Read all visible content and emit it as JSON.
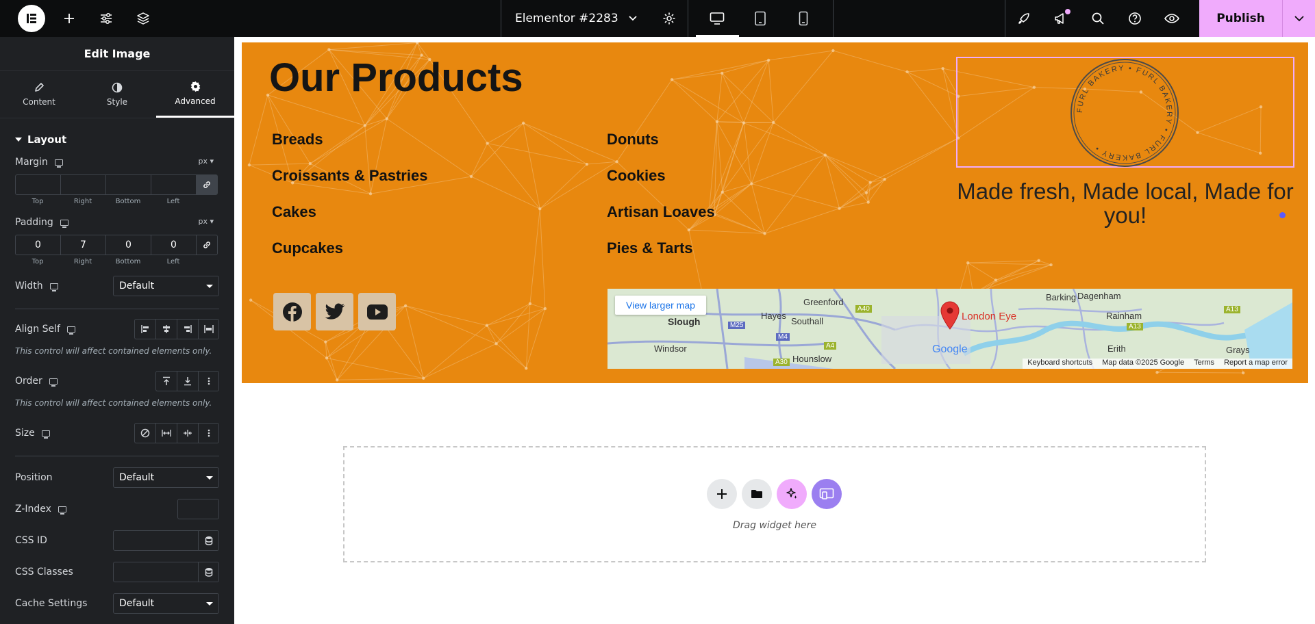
{
  "topbar": {
    "doc_title": "Elementor #2283",
    "publish_label": "Publish"
  },
  "panel": {
    "title": "Edit Image",
    "tabs": [
      {
        "label": "Content",
        "icon": "pencil-icon"
      },
      {
        "label": "Style",
        "icon": "half-circle-icon"
      },
      {
        "label": "Advanced",
        "icon": "gear-icon",
        "active": true
      }
    ],
    "section": "Layout",
    "margin": {
      "label": "Margin",
      "unit": "px",
      "top": "",
      "right": "",
      "bottom": "",
      "left": ""
    },
    "padding": {
      "label": "Padding",
      "unit": "px",
      "top": "0",
      "right": "7",
      "bottom": "0",
      "left": "0"
    },
    "dim_labels": {
      "top": "Top",
      "right": "Right",
      "bottom": "Bottom",
      "left": "Left"
    },
    "width": {
      "label": "Width",
      "value": "Default"
    },
    "align_self": {
      "label": "Align Self",
      "note": "This control will affect contained elements only."
    },
    "order": {
      "label": "Order",
      "note": "This control will affect contained elements only."
    },
    "size": {
      "label": "Size"
    },
    "position": {
      "label": "Position",
      "value": "Default"
    },
    "zindex": {
      "label": "Z-Index"
    },
    "css_id": {
      "label": "CSS ID"
    },
    "css_classes": {
      "label": "CSS Classes"
    },
    "cache": {
      "label": "Cache Settings",
      "value": "Default"
    }
  },
  "page": {
    "heading": "Our Products",
    "products_left": [
      "Breads",
      "Croissants & Pastries",
      "Cakes",
      "Cupcakes"
    ],
    "products_right": [
      "Donuts",
      "Cookies",
      "Artisan Loaves",
      "Pies & Tarts"
    ],
    "tagline": "Made fresh, Made local, Made for you!",
    "stamp_text": "FURL BAKERY • FURL BAKERY • FURL BAKERY •",
    "map": {
      "button": "View larger map",
      "marker": "London Eye",
      "places": [
        "Slough",
        "Hayes",
        "Southall",
        "Greenford",
        "Windsor",
        "Hounslow",
        "Barking",
        "Dagenham",
        "Rainham",
        "Erith",
        "Grays"
      ],
      "roads": [
        "M25",
        "M4",
        "A4",
        "A30",
        "A40",
        "A13",
        "A13"
      ],
      "google": "Google",
      "attribution": [
        "Keyboard shortcuts",
        "Map data ©2025 Google",
        "Terms",
        "Report a map error"
      ]
    },
    "drop_text": "Drag widget here"
  },
  "colors": {
    "accent": "#f0abfc",
    "section_bg": "#e8880f",
    "panel_bg": "#1f2124"
  }
}
